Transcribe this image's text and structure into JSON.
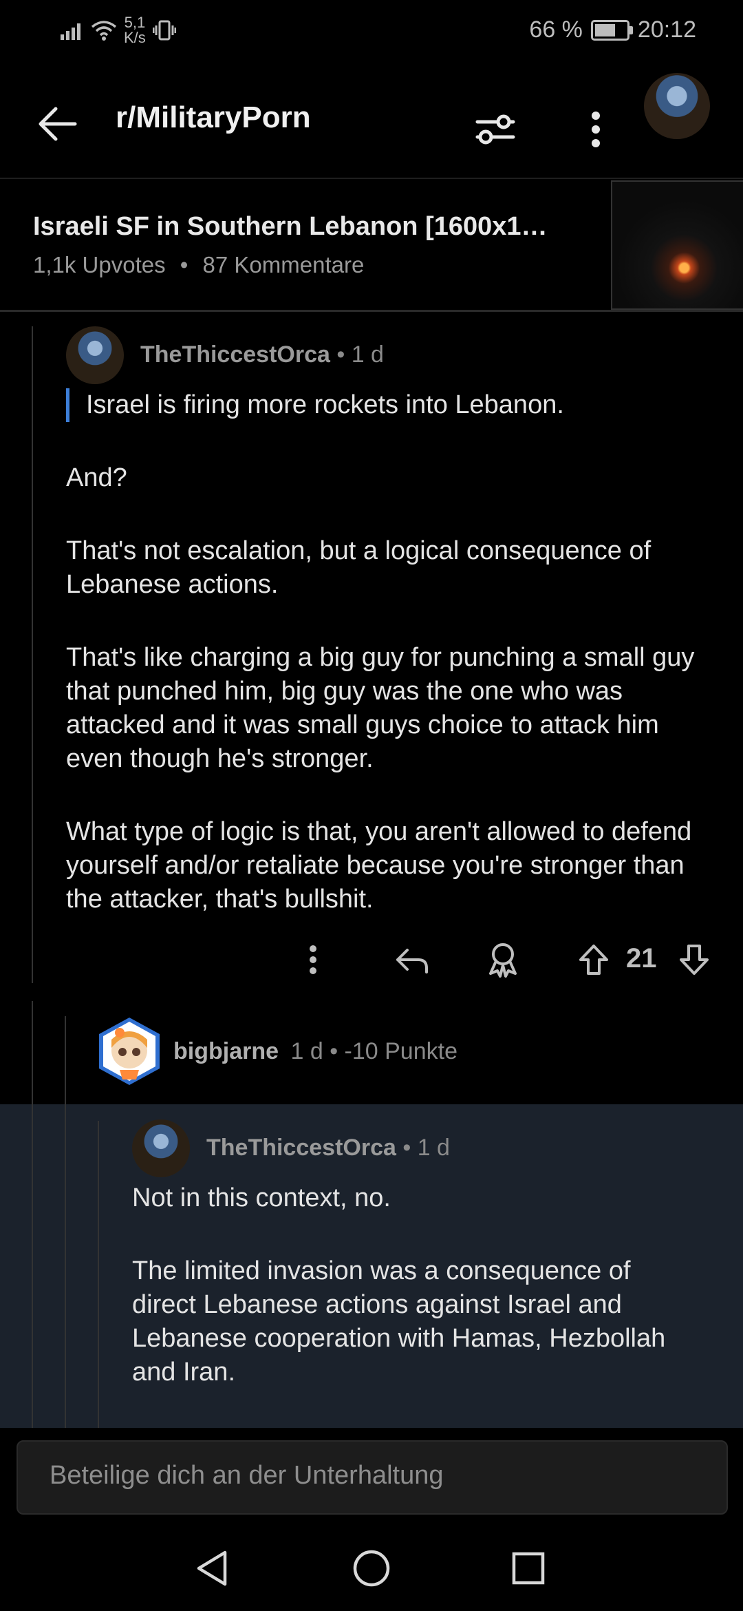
{
  "status_bar": {
    "speed_value": "5,1",
    "speed_unit": "K/s",
    "battery": "66 %",
    "battery_level": 0.66,
    "time": "20:12"
  },
  "app_bar": {
    "subreddit": "r/MilitaryPorn"
  },
  "post": {
    "title": "Israeli SF in Southern Lebanon [1600x1…",
    "upvotes": "1,1k Upvotes",
    "separator": "•",
    "comments": "87 Kommentare"
  },
  "comment1": {
    "author": "TheThiccestOrca",
    "age": "• 1 d",
    "quote": "Israel is firing more rockets into Lebanon.",
    "paragraphs": [
      "And?",
      "That's not escalation, but a logical consequence of Lebanese actions.",
      "That's like charging a big guy for punching a small guy that punched him, big guy was the one who was attacked and it was small guys choice to attack him even though he's stronger.",
      "What type of logic is that, you aren't allowed to defend yourself and/or retaliate because you're stronger than the attacker, that's bullshit."
    ],
    "votes": "21"
  },
  "comment2": {
    "author": "bigbjarne",
    "meta": "1 d • -10 Punkte"
  },
  "comment3": {
    "author": "TheThiccestOrca",
    "age": "• 1 d",
    "paragraphs": [
      "Not in this context, no.",
      "The limited invasion was a consequence of direct Lebanese actions against Israel and Lebanese cooperation with Hamas, Hezbollah and Iran."
    ]
  },
  "composer": {
    "placeholder": "Beteilige dich an der Unterhaltung"
  },
  "icons": {
    "back": "arrow-left-icon",
    "filter": "sliders-icon",
    "more": "more-vertical-icon",
    "reply": "reply-icon",
    "award": "award-icon",
    "upvote": "upvote-icon",
    "downvote": "downvote-icon"
  },
  "colors": {
    "background": "#000000",
    "highlight": "#1b222c",
    "quote_bar": "#3d7fd9"
  }
}
